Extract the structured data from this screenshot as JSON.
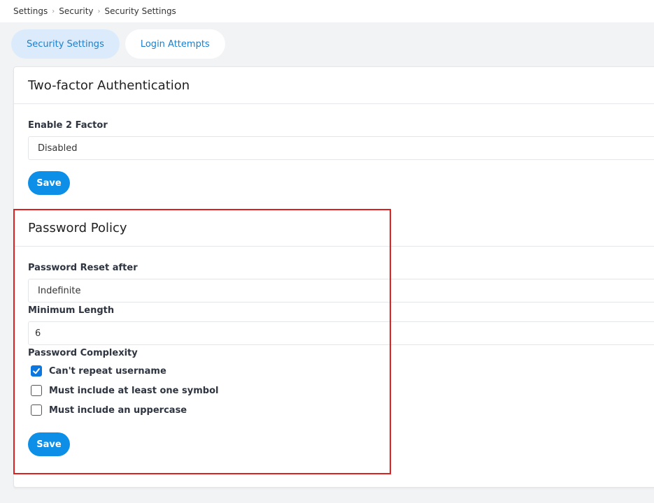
{
  "breadcrumb": [
    "Settings",
    "Security",
    "Security Settings"
  ],
  "tabs": [
    {
      "label": "Security Settings",
      "active": true
    },
    {
      "label": "Login Attempts",
      "active": false
    }
  ],
  "two_factor": {
    "title": "Two-factor Authentication",
    "enable_label": "Enable 2 Factor",
    "enable_value": "Disabled",
    "save_label": "Save"
  },
  "password_policy": {
    "title": "Password Policy",
    "reset_label": "Password Reset after",
    "reset_value": "Indefinite",
    "min_length_label": "Minimum Length",
    "min_length_value": "6",
    "complexity_label": "Password Complexity",
    "options": [
      {
        "label": "Can't repeat username",
        "checked": true
      },
      {
        "label": "Must include at least one symbol",
        "checked": false
      },
      {
        "label": "Must include an uppercase",
        "checked": false
      }
    ],
    "save_label": "Save"
  },
  "colors": {
    "accent": "#0d8fe8",
    "highlight_border": "#e01f1f",
    "active_tab_bg": "#dcebfb"
  }
}
